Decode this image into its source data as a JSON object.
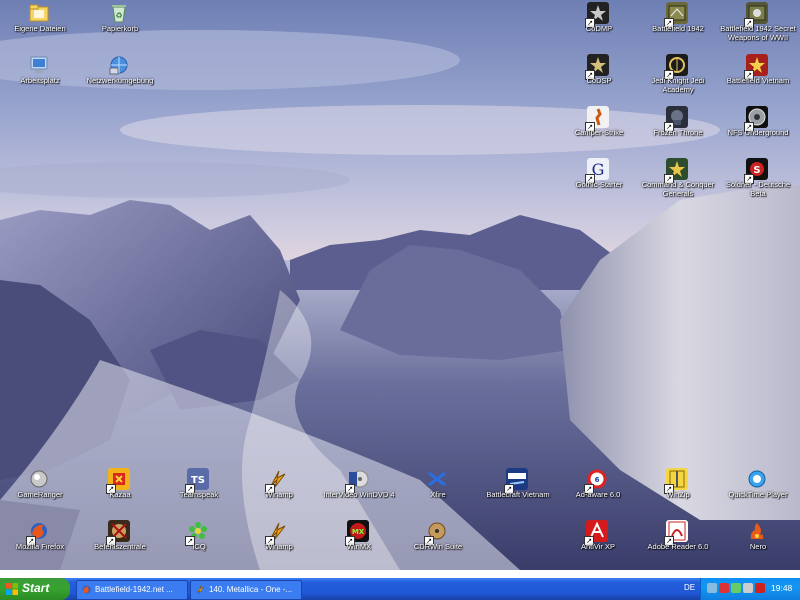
{
  "desktop": {
    "icons_left": [
      {
        "label": "Eigene Dateien",
        "icon": "my-documents-icon"
      },
      {
        "label": "Papierkorb",
        "icon": "recycle-bin-icon"
      },
      {
        "label": "Arbeitsplatz",
        "icon": "my-computer-icon"
      },
      {
        "label": "Netzwerkumgebung",
        "icon": "network-places-icon"
      }
    ],
    "icons_right": [
      {
        "label": "CoDMP",
        "icon": "codmp-icon"
      },
      {
        "label": "Battlefield 1942",
        "icon": "battlefield-1942-icon"
      },
      {
        "label": "Battlefield 1942 Secret Weapons of WWII",
        "icon": "battlefield-secret-weapons-icon"
      },
      {
        "label": "CoDSP",
        "icon": "codsp-icon"
      },
      {
        "label": "Jedi Knight Jedi Academy",
        "icon": "jedi-academy-icon"
      },
      {
        "label": "Battlefield Vietnam",
        "icon": "battlefield-vietnam-icon"
      },
      {
        "label": "Camper-Strike",
        "icon": "camper-strike-icon"
      },
      {
        "label": "Frozen Throne",
        "icon": "frozen-throne-icon"
      },
      {
        "label": "NFS Underground",
        "icon": "nfs-underground-icon"
      },
      {
        "label": "Gothic-Starter",
        "icon": "gothic-starter-icon"
      },
      {
        "label": "Command & Conquer Generals",
        "icon": "cnc-generals-icon"
      },
      {
        "label": "Soldner - Deutsche Beta",
        "icon": "soldner-icon"
      }
    ],
    "icons_bottom_row1": [
      {
        "label": "GameRanger",
        "icon": "gameranger-icon"
      },
      {
        "label": "Kazaa",
        "icon": "kazaa-icon"
      },
      {
        "label": "Teamspeak",
        "icon": "teamspeak-icon"
      },
      {
        "label": "Winamp",
        "icon": "winamp-icon"
      },
      {
        "label": "InterVideo WinDVD 4",
        "icon": "windvd-icon"
      },
      {
        "label": "Xfire",
        "icon": "xfire-icon"
      },
      {
        "label": "Battlecraft Vietnam",
        "icon": "battlecraft-vietnam-icon"
      },
      {
        "label": "Ad-aware 6.0",
        "icon": "ad-aware-icon"
      },
      {
        "label": "WinZip",
        "icon": "winzip-icon"
      },
      {
        "label": "QuickTime Player",
        "icon": "quicktime-icon"
      }
    ],
    "icons_bottom_row2": [
      {
        "label": "Mozilla Firefox",
        "icon": "firefox-icon"
      },
      {
        "label": "Befehlszentrale",
        "icon": "befehlszentrale-icon"
      },
      {
        "label": "ICQ",
        "icon": "icq-icon"
      },
      {
        "label": "Winamp",
        "icon": "winamp2-icon"
      },
      {
        "label": "WinMX",
        "icon": "winmx-icon"
      },
      {
        "label": "CDRWin Suite",
        "icon": "cdrwin-icon"
      },
      {
        "label": "AntiVir XP",
        "icon": "antivir-icon"
      },
      {
        "label": "Adobe Reader 6.0",
        "icon": "adobe-reader-icon"
      },
      {
        "label": "Nero",
        "icon": "nero-icon"
      }
    ]
  },
  "taskbar": {
    "start_label": "Start",
    "tasks": [
      {
        "label": "Battlefield-1942.net ...",
        "icon": "firefox-icon"
      },
      {
        "label": "140. Metallica - One -...",
        "icon": "winamp-icon"
      }
    ],
    "language": "DE",
    "clock": "19:48"
  }
}
